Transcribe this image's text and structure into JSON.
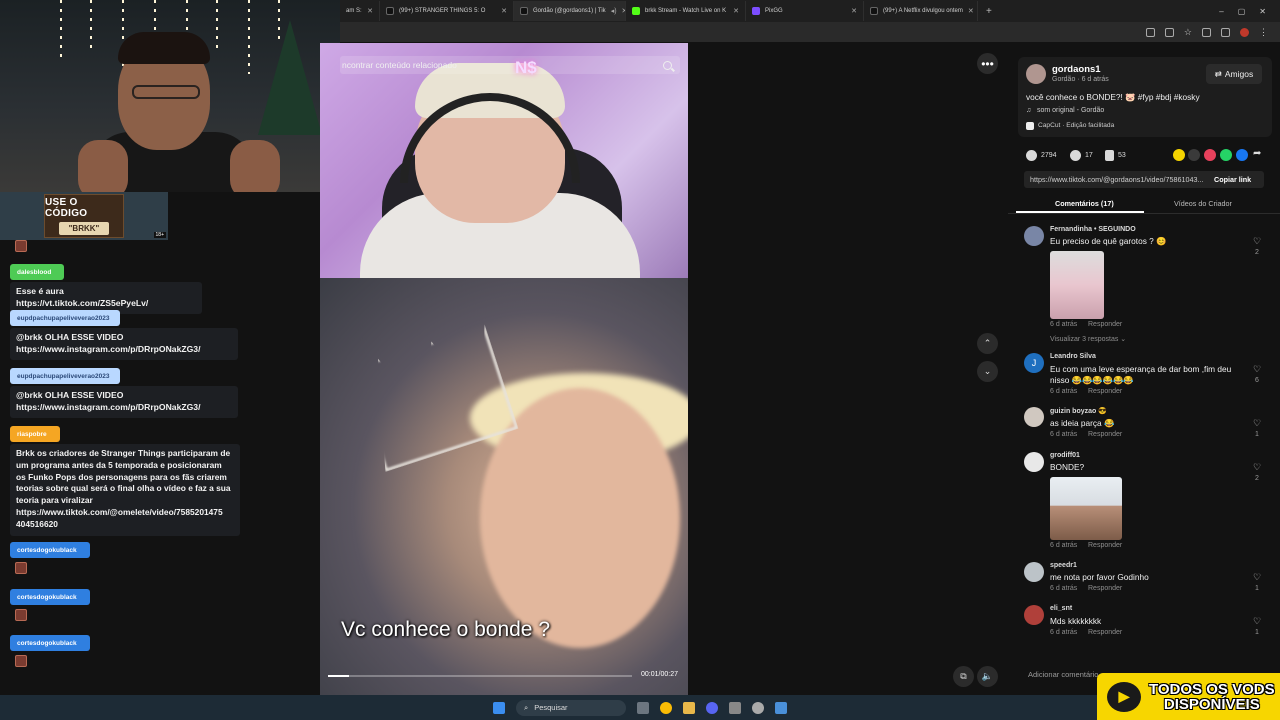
{
  "browser": {
    "tabs": [
      {
        "label": "am S:"
      },
      {
        "label": "(99+) STRANGER THINGS 5: O"
      },
      {
        "label": "Gordão (@gordaons1) | Tik"
      },
      {
        "label": "brkk Stream - Watch Live on K"
      },
      {
        "label": "PixGG"
      },
      {
        "label": "(99+) A Netflix divulgou ontem"
      }
    ],
    "new_tab": "+",
    "window_controls": [
      "–",
      "▢",
      "✕"
    ]
  },
  "code_banner": {
    "line1": "USE O CÓDIGO",
    "line2": "\"BRKK\"",
    "age": "18+"
  },
  "chat": {
    "messages": [
      {
        "user": "dalesblood",
        "text": "Esse é aura https://vt.tiktok.com/ZS5ePyeLv/",
        "color": "#4ecb55"
      },
      {
        "user": "eupdpachupapeliveverao2023",
        "text": "@brkk OLHA ESSE VIDEO\nhttps://www.instagram.com/p/DRrpONakZG3/",
        "color": "#b9d8ff"
      },
      {
        "user": "eupdpachupapeliveverao2023",
        "text": "@brkk OLHA ESSE VIDEO\nhttps://www.instagram.com/p/DRrpONakZG3/",
        "color": "#b9d8ff"
      },
      {
        "user": "riaspobre",
        "text": "Brkk os criadores de Stranger Things participaram de\num programa antes da 5 temporada e posicionaram\nos Funko Pops dos personagens para os fãs criarem\nteorias sobre qual será o final olha o vídeo e faz a sua\nteoria para viralizar\nhttps://www.tiktok.com/@omelete/video/7585201475\n404516620",
        "color": "#f5a623"
      },
      {
        "user": "cortesdogokublack",
        "color": "#2f7fe0"
      },
      {
        "user": "cortesdogokublack",
        "color": "#2f7fe0"
      },
      {
        "user": "cortesdogokublack",
        "color": "#2f7fe0"
      }
    ]
  },
  "video": {
    "search_placeholder": "ncontrar conteúdo relacionado",
    "caption": "Vc conhece o bonde ?",
    "time": "00:01/00:27",
    "progress": 0.07,
    "watermark": "N$"
  },
  "post": {
    "username": "gordaons1",
    "subline": "Gordão · 6 d atrás",
    "follow_label": "Amigos",
    "description": "você conhece o BONDE?! 🐷 #fyp #bdj #kosky",
    "sound": "som original - Gordão",
    "capcut": "CapCut · Edição facilitada",
    "likes": "2794",
    "comments": "17",
    "saves": "53",
    "url": "https://www.tiktok.com/@gordaons1/video/75861043...",
    "copy_label": "Copiar link",
    "share_colors": [
      "#f5d400",
      "#3a3a3a",
      "#e8415c",
      "#25d366",
      "#1877f2"
    ]
  },
  "tabs_right": {
    "comments": "Comentários (17)",
    "creator": "Vídeos do Criador"
  },
  "comments": [
    {
      "user": "Fernandinha • SEGUINDO",
      "text": "Eu preciso de quê garotos ? 😊",
      "time": "6 d atrás",
      "reply": "Responder",
      "likes": "2",
      "extra": "Visualizar 3 respostas ⌄"
    },
    {
      "user": "Leandro Silva",
      "text": "Eu com uma leve esperança de dar bom ,fim deu\nnisso 😂😂😂😂😂😂",
      "time": "6 d atrás",
      "reply": "Responder",
      "likes": "6",
      "avatar_letter": "J"
    },
    {
      "user": "guizin boyzao 😎",
      "text": "as ideia parça 😂",
      "time": "6 d atrás",
      "reply": "Responder",
      "likes": "1"
    },
    {
      "user": "grodiff01",
      "text": "BONDE?",
      "time": "6 d atrás",
      "reply": "Responder",
      "likes": "2"
    },
    {
      "user": "speedr1",
      "text": "me nota por favor Godinho",
      "time": "6 d atrás",
      "reply": "Responder",
      "likes": "1"
    },
    {
      "user": "eli_snt",
      "text": "Mds kkkkkkkk",
      "time": "6 d atrás",
      "reply": "Responder",
      "likes": "1"
    }
  ],
  "add_comment": "Adicionar comentário...",
  "taskbar": {
    "search": "Pesquisar"
  },
  "overlay": {
    "text": "TODOS OS VODS\nDISPONÍVEIS"
  }
}
